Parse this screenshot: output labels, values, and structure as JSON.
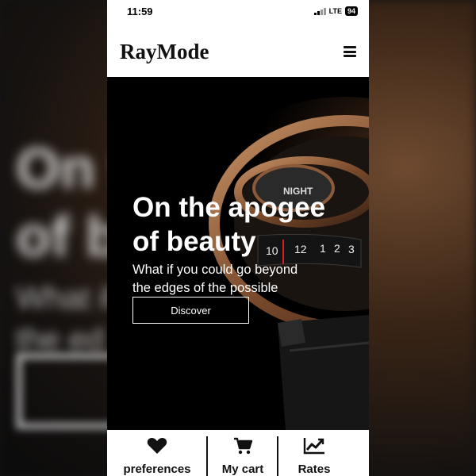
{
  "status_bar": {
    "time": "11:59",
    "network": "LTE",
    "battery": "94"
  },
  "header": {
    "brand": "RayMode"
  },
  "hero": {
    "title_line1": "On the apogee",
    "title_line2": "of beauty",
    "subtitle_line1": "What if you could go beyond",
    "subtitle_line2": "the edges of the possible",
    "button_label": "Discover",
    "watch_numerals": [
      "10",
      "12",
      "1",
      "2",
      "3"
    ],
    "watch_brand": "NIGHT"
  },
  "tabbar": {
    "items": [
      {
        "label": "preferences",
        "icon": "heart-icon"
      },
      {
        "label": "My cart",
        "icon": "cart-icon"
      },
      {
        "label": "Rates",
        "icon": "chart-line-icon"
      }
    ]
  },
  "colors": {
    "bronze": "#8a5a3a",
    "background": "#000000",
    "surface": "#ffffff"
  }
}
